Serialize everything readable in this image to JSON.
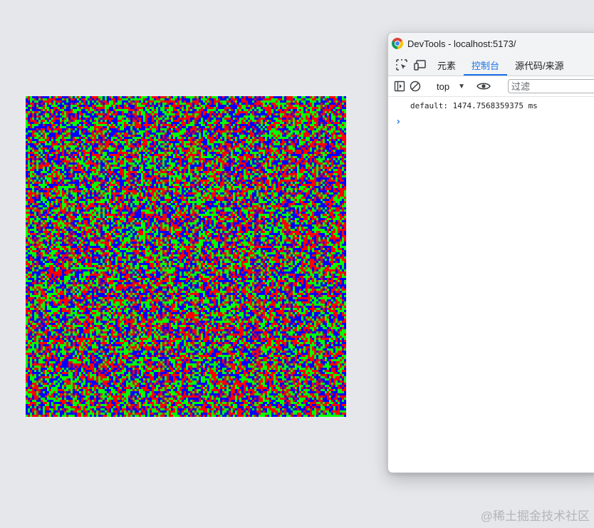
{
  "canvas": {
    "colors": [
      "#ff0000",
      "#00ff00",
      "#0000ff"
    ],
    "resolution": 150
  },
  "devtools": {
    "window_title": "DevTools - localhost:5173/",
    "tabs": [
      {
        "label": "元素",
        "active": false
      },
      {
        "label": "控制台",
        "active": true
      },
      {
        "label": "源代码/来源",
        "active": false
      }
    ],
    "toolbar": {
      "context": "top",
      "filter_placeholder": "过滤"
    },
    "console": {
      "messages": [
        "default: 1474.7568359375 ms"
      ],
      "prompt_symbol": "›"
    },
    "accent_color": "#1a73e8"
  },
  "watermark": "@稀土掘金技术社区"
}
